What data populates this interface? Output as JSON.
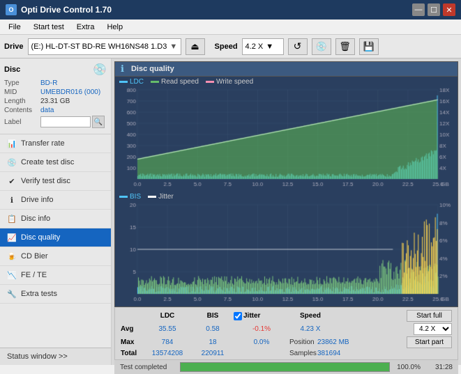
{
  "app": {
    "title": "Opti Drive Control 1.70",
    "icon": "O"
  },
  "titlebar": {
    "minimize": "—",
    "maximize": "☐",
    "close": "✕"
  },
  "menubar": {
    "items": [
      "File",
      "Start test",
      "Extra",
      "Help"
    ]
  },
  "drivebar": {
    "label": "Drive",
    "drive_value": "(E:)  HL-DT-ST BD-RE  WH16NS48 1.D3",
    "speed_label": "Speed",
    "speed_value": "4.2 X"
  },
  "disc": {
    "title": "Disc",
    "type_label": "Type",
    "type_value": "BD-R",
    "mid_label": "MID",
    "mid_value": "UMEBDR016 (000)",
    "length_label": "Length",
    "length_value": "23.31 GB",
    "contents_label": "Contents",
    "contents_value": "data",
    "label_label": "Label",
    "label_value": ""
  },
  "nav": {
    "items": [
      {
        "id": "transfer-rate",
        "label": "Transfer rate",
        "active": false
      },
      {
        "id": "create-test-disc",
        "label": "Create test disc",
        "active": false
      },
      {
        "id": "verify-test-disc",
        "label": "Verify test disc",
        "active": false
      },
      {
        "id": "drive-info",
        "label": "Drive info",
        "active": false
      },
      {
        "id": "disc-info",
        "label": "Disc info",
        "active": false
      },
      {
        "id": "disc-quality",
        "label": "Disc quality",
        "active": true
      },
      {
        "id": "cd-bier",
        "label": "CD Bier",
        "active": false
      },
      {
        "id": "fe-te",
        "label": "FE / TE",
        "active": false
      },
      {
        "id": "extra-tests",
        "label": "Extra tests",
        "active": false
      }
    ]
  },
  "status_window": "Status window >>",
  "chart": {
    "title": "Disc quality",
    "legend_ldc": "LDC",
    "legend_read": "Read speed",
    "legend_write": "Write speed",
    "legend_bis": "BIS",
    "legend_jitter": "Jitter",
    "top": {
      "y_max": 800,
      "y_right_max": 18,
      "x_max": 25,
      "x_labels": [
        "0.0",
        "2.5",
        "5.0",
        "7.5",
        "10.0",
        "12.5",
        "15.0",
        "17.5",
        "20.0",
        "22.5",
        "25.0"
      ],
      "y_left_labels": [
        "100",
        "200",
        "300",
        "400",
        "500",
        "600",
        "700",
        "800"
      ],
      "y_right_labels": [
        "4X",
        "6X",
        "8X",
        "10X",
        "12X",
        "14X",
        "16X",
        "18X"
      ],
      "unit": "GB"
    },
    "bottom": {
      "y_max": 20,
      "y_right_max": 10,
      "x_max": 25,
      "x_labels": [
        "0.0",
        "2.5",
        "5.0",
        "7.5",
        "10.0",
        "12.5",
        "15.0",
        "17.5",
        "20.0",
        "22.5",
        "25.0"
      ],
      "y_left_labels": [
        "5",
        "10",
        "15",
        "20"
      ],
      "y_right_labels": [
        "2%",
        "4%",
        "6%",
        "8%",
        "10%"
      ],
      "unit": "GB"
    }
  },
  "stats": {
    "col_ldc": "LDC",
    "col_bis": "BIS",
    "col_jitter": "Jitter",
    "col_speed": "Speed",
    "avg_label": "Avg",
    "avg_ldc": "35.55",
    "avg_bis": "0.58",
    "avg_jitter": "-0.1%",
    "avg_speed": "4.23 X",
    "max_label": "Max",
    "max_ldc": "784",
    "max_bis": "18",
    "max_jitter": "0.0%",
    "max_position": "23862 MB",
    "total_label": "Total",
    "total_ldc": "13574208",
    "total_bis": "220911",
    "total_samples": "381694",
    "position_label": "Position",
    "samples_label": "Samples",
    "speed_combo_value": "4.2 X",
    "start_full_label": "Start full",
    "start_part_label": "Start part",
    "jitter_checked": true,
    "jitter_label": "Jitter"
  },
  "progress": {
    "label": "Test completed",
    "percent": 100,
    "percent_display": "100.0%",
    "time": "31:28"
  }
}
